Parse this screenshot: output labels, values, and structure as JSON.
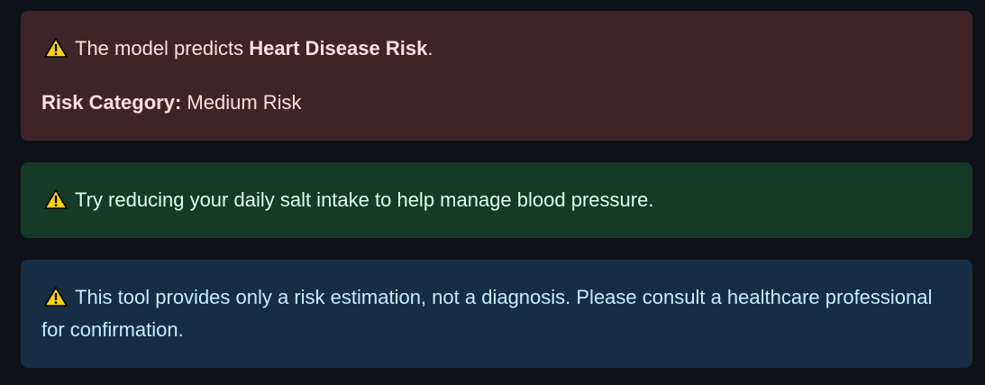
{
  "alerts": {
    "prediction": {
      "icon": "warning-icon",
      "prefix": "The model predicts ",
      "result": "Heart Disease Risk",
      "suffix": ".",
      "category_label": "Risk Category:",
      "category_value": " Medium Risk",
      "background": "#3e2428",
      "text_color": "#ffdede"
    },
    "tip": {
      "icon": "warning-icon",
      "text": "Try reducing your daily salt intake to help manage blood pressure.",
      "background": "#173928",
      "text_color": "#dffde9"
    },
    "disclaimer": {
      "icon": "warning-icon",
      "text": "This tool provides only a risk estimation, not a diagnosis. Please consult a healthcare professional for confirmation.",
      "background": "#172d43",
      "text_color": "#c7ebff"
    }
  },
  "icon_colors": {
    "warning_fill": "#f7d21a",
    "warning_stroke": "#000000"
  }
}
